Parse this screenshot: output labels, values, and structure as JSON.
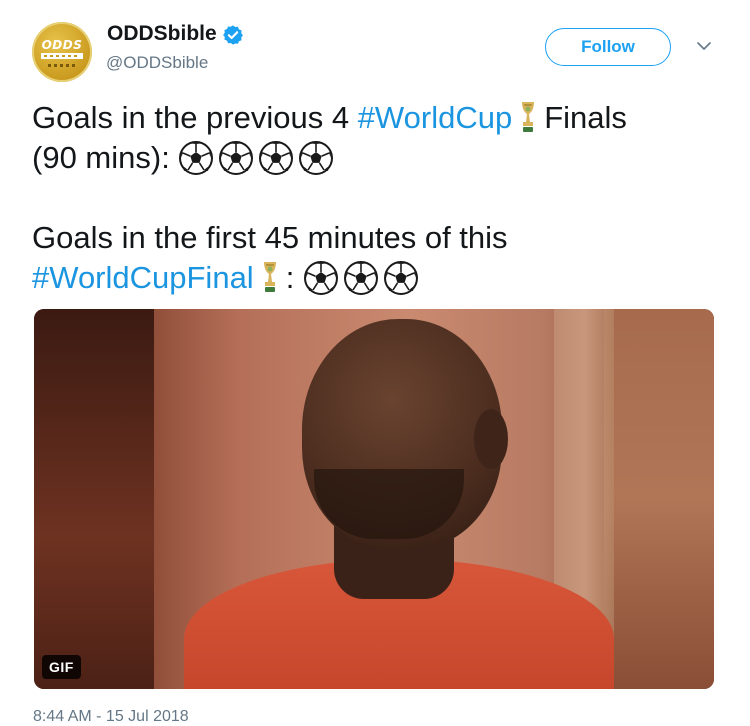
{
  "account": {
    "display_name": "ODDSbible",
    "handle": "@ODDSbible",
    "avatar_text": "ODDS",
    "verified": true
  },
  "follow_button": {
    "label": "Follow"
  },
  "tweet": {
    "line1_text": "Goals in the previous 4 ",
    "line1_hashtag": "#WorldCup",
    "line1_trophy_icon": "trophy-icon",
    "line1_end": "Finals",
    "line2_text": "(90 mins):",
    "line2_ball_count": 4,
    "line3_text": "Goals in the first 45 minutes of this",
    "line4_hashtag": "#WorldCupFinal",
    "line4_trophy_icon": "trophy-icon",
    "line4_sep": ":",
    "line4_ball_count": 3
  },
  "media": {
    "type": "gif",
    "badge": "GIF"
  },
  "timestamp": "8:44 AM - 15 Jul 2018",
  "colors": {
    "link": "#1b95e0",
    "follow_blue": "#1da1f2",
    "secondary_text": "#657786",
    "primary_text": "#14171a"
  }
}
